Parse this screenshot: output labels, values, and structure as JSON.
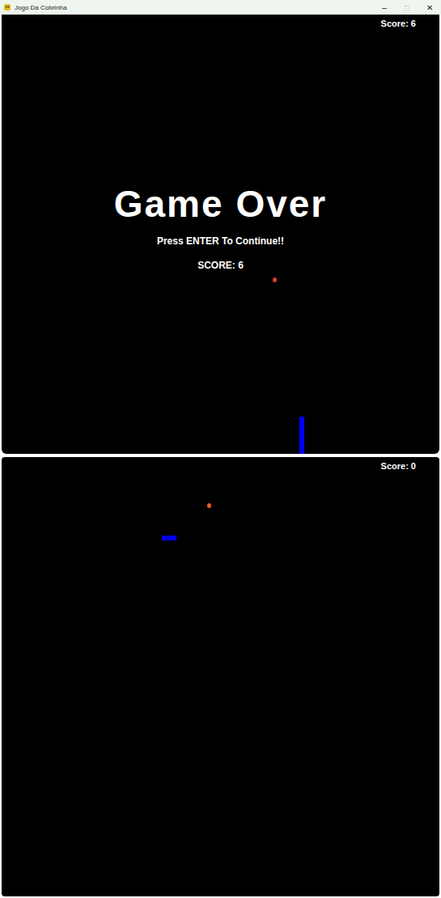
{
  "window": {
    "title": "Jogo Da Cobrinha",
    "controls": [
      {
        "label": "–",
        "disabled": false
      },
      {
        "label": "□",
        "disabled": true
      },
      {
        "label": "✕",
        "disabled": false
      }
    ]
  },
  "screens": [
    {
      "score": "Score: 6",
      "game_over": {
        "title": "Game Over",
        "prompt": "Press ENTER To Continue!!",
        "final_score": "SCORE: 6"
      },
      "apple": {
        "color": "#d9402a"
      },
      "snake": {
        "color": "#0000ff",
        "direction": "vertical"
      }
    },
    {
      "score": "Score: 0",
      "game_over": null,
      "apple": {
        "color": "#e0602a"
      },
      "snake": {
        "color": "#0000ff",
        "direction": "horizontal"
      }
    }
  ]
}
